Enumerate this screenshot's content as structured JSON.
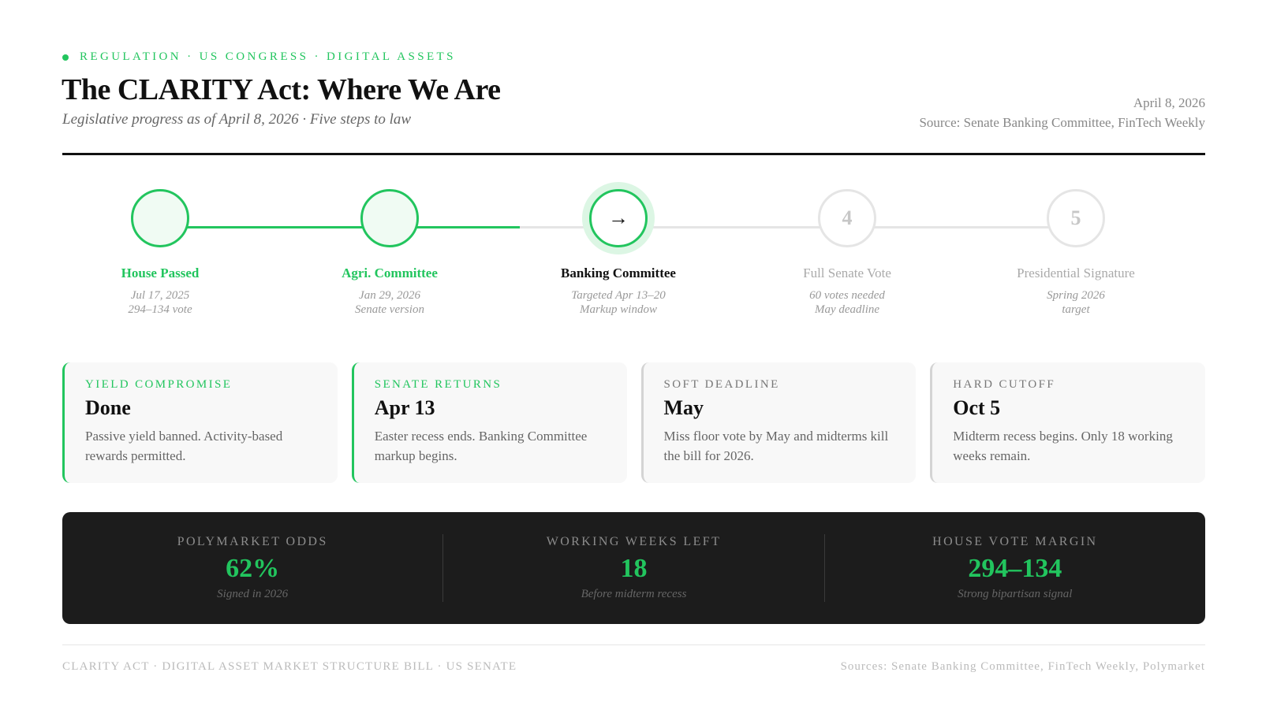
{
  "header": {
    "eyebrow": "REGULATION · US CONGRESS · DIGITAL ASSETS",
    "title": "The CLARITY Act: Where We Are",
    "subtitle": "Legislative progress as of April 8, 2026 · Five steps to law",
    "date": "April 8, 2026",
    "source": "Source: Senate Banking Committee, FinTech Weekly"
  },
  "steps": [
    {
      "status": "done",
      "symbol": "",
      "name": "House Passed",
      "line1": "Jul 17, 2025",
      "line2": "294–134 vote"
    },
    {
      "status": "done",
      "symbol": "",
      "name": "Agri. Committee",
      "line1": "Jan 29, 2026",
      "line2": "Senate version"
    },
    {
      "status": "current",
      "symbol": "→",
      "name": "Banking Committee",
      "line1": "Targeted Apr 13–20",
      "line2": "Markup window"
    },
    {
      "status": "future",
      "symbol": "4",
      "name": "Full Senate Vote",
      "line1": "60 votes needed",
      "line2": "May deadline"
    },
    {
      "status": "future",
      "symbol": "5",
      "name": "Presidential Signature",
      "line1": "Spring 2026",
      "line2": "target"
    }
  ],
  "cards": [
    {
      "label": "YIELD COMPROMISE",
      "value": "Done",
      "desc": "Passive yield banned. Activity-based rewards permitted."
    },
    {
      "label": "SENATE RETURNS",
      "value": "Apr 13",
      "desc": "Easter recess ends. Banking Committee markup begins."
    },
    {
      "label": "SOFT DEADLINE",
      "value": "May",
      "desc": "Miss floor vote by May and midterms kill the bill for 2026."
    },
    {
      "label": "HARD CUTOFF",
      "value": "Oct 5",
      "desc": "Midterm recess begins. Only 18 working weeks remain."
    }
  ],
  "stats": [
    {
      "label": "POLYMARKET ODDS",
      "value": "62%",
      "note": "Signed in 2026"
    },
    {
      "label": "WORKING WEEKS LEFT",
      "value": "18",
      "note": "Before midterm recess"
    },
    {
      "label": "HOUSE VOTE MARGIN",
      "value": "294–134",
      "note": "Strong bipartisan signal"
    }
  ],
  "footer": {
    "left": "CLARITY ACT · DIGITAL ASSET MARKET STRUCTURE BILL · US SENATE",
    "right": "Sources: Senate Banking Committee, FinTech Weekly, Polymarket"
  },
  "colors": {
    "accent": "#22c55e",
    "dark_panel": "#1c1c1c",
    "inactive": "#e5e5e5"
  }
}
